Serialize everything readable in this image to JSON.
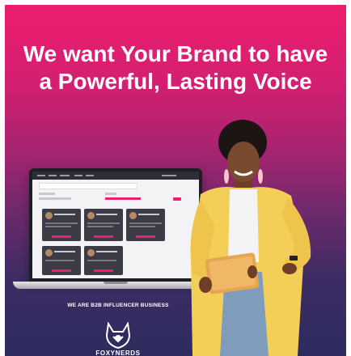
{
  "banner": {
    "headline_line1": "We want Your Brand to have",
    "headline_line2": "a Powerful, Lasting Voice",
    "tagline": "WE ARE B2B INFLUENCER BUSINESS",
    "logo_text": "FOXYNERDS"
  },
  "colors": {
    "gradient_top": "#ee1e6e",
    "gradient_bottom": "#2d2c5f",
    "accent": "#ee1e6e",
    "text": "#ffffff"
  },
  "icons": {
    "logo": "fox-head-logo-icon"
  }
}
